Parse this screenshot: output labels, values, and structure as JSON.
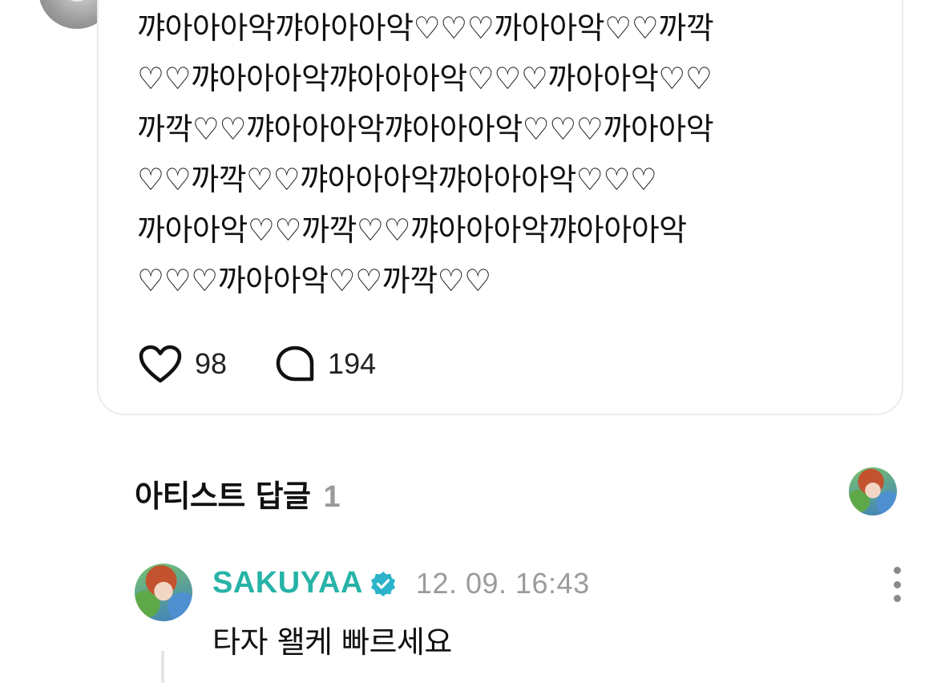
{
  "post": {
    "body": "꺄아아아악꺄아아아악♡♡♡까아아악♡♡까깍\n♡♡꺄아아아악꺄아아아악♡♡♡까아아악♡♡\n까깍♡♡꺄아아아악꺄아아아악♡♡♡까아아악\n♡♡까깍♡♡꺄아아아악꺄아아아악♡♡♡\n까아아악♡♡까깍♡♡꺄아아아악꺄아아아악\n♡♡♡까아아악♡♡까깍♡♡",
    "likes": "98",
    "comments": "194"
  },
  "artist_replies": {
    "title": "아티스트 답글",
    "count": "1"
  },
  "comment": {
    "author": "SAKUYAA",
    "timestamp": "12. 09. 16:43",
    "text": "타자 왤케 빠르세요"
  },
  "colors": {
    "author": "#27b3a7",
    "verified_badge": "#2bb3c9",
    "muted": "#9b9b9b"
  },
  "icons": {
    "like": "heart-outline-icon",
    "comment": "speech-bubble-icon",
    "verified": "verified-badge-icon",
    "more": "more-vertical-icon"
  }
}
